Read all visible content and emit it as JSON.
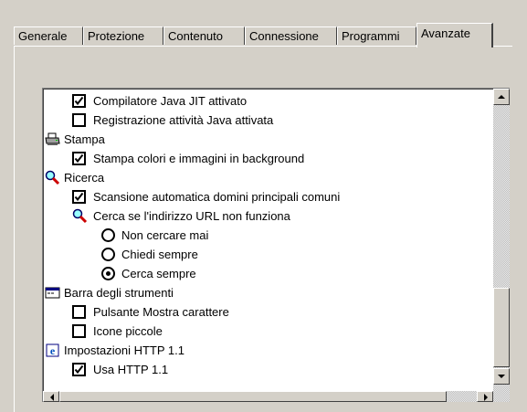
{
  "tabs": [
    {
      "label": "Generale"
    },
    {
      "label": "Protezione"
    },
    {
      "label": "Contenuto"
    },
    {
      "label": "Connessione"
    },
    {
      "label": "Programmi"
    },
    {
      "label": "Avanzate",
      "active": true
    }
  ],
  "tree": {
    "items": [
      {
        "type": "checkbox",
        "checked": true,
        "label": "Compilatore Java JIT attivato"
      },
      {
        "type": "checkbox",
        "checked": false,
        "label": "Registrazione attività Java attivata"
      },
      {
        "type": "category",
        "icon": "printer-icon",
        "label": "Stampa"
      },
      {
        "type": "checkbox",
        "checked": true,
        "label": "Stampa colori e immagini in background"
      },
      {
        "type": "category",
        "icon": "magnifier-icon",
        "label": "Ricerca"
      },
      {
        "type": "checkbox",
        "checked": true,
        "label": "Scansione automatica domini principali comuni"
      },
      {
        "type": "subcategory",
        "icon": "magnifier-icon",
        "label": "Cerca se l'indirizzo URL non funziona"
      },
      {
        "type": "radio",
        "selected": false,
        "label": "Non cercare mai"
      },
      {
        "type": "radio",
        "selected": false,
        "label": "Chiedi sempre"
      },
      {
        "type": "radio",
        "selected": true,
        "label": "Cerca sempre"
      },
      {
        "type": "category",
        "icon": "toolbar-icon",
        "label": "Barra degli strumenti"
      },
      {
        "type": "checkbox",
        "checked": false,
        "label": "Pulsante Mostra carattere"
      },
      {
        "type": "checkbox",
        "checked": false,
        "label": "Icone piccole"
      },
      {
        "type": "category",
        "icon": "ie-icon",
        "label": "Impostazioni HTTP 1.1"
      },
      {
        "type": "checkbox",
        "checked": true,
        "label": "Usa HTTP 1.1"
      }
    ]
  },
  "colors": {
    "face": "#d4d0c8",
    "highlight": "#ffffff",
    "shadow": "#808080",
    "dark_shadow": "#404040"
  }
}
